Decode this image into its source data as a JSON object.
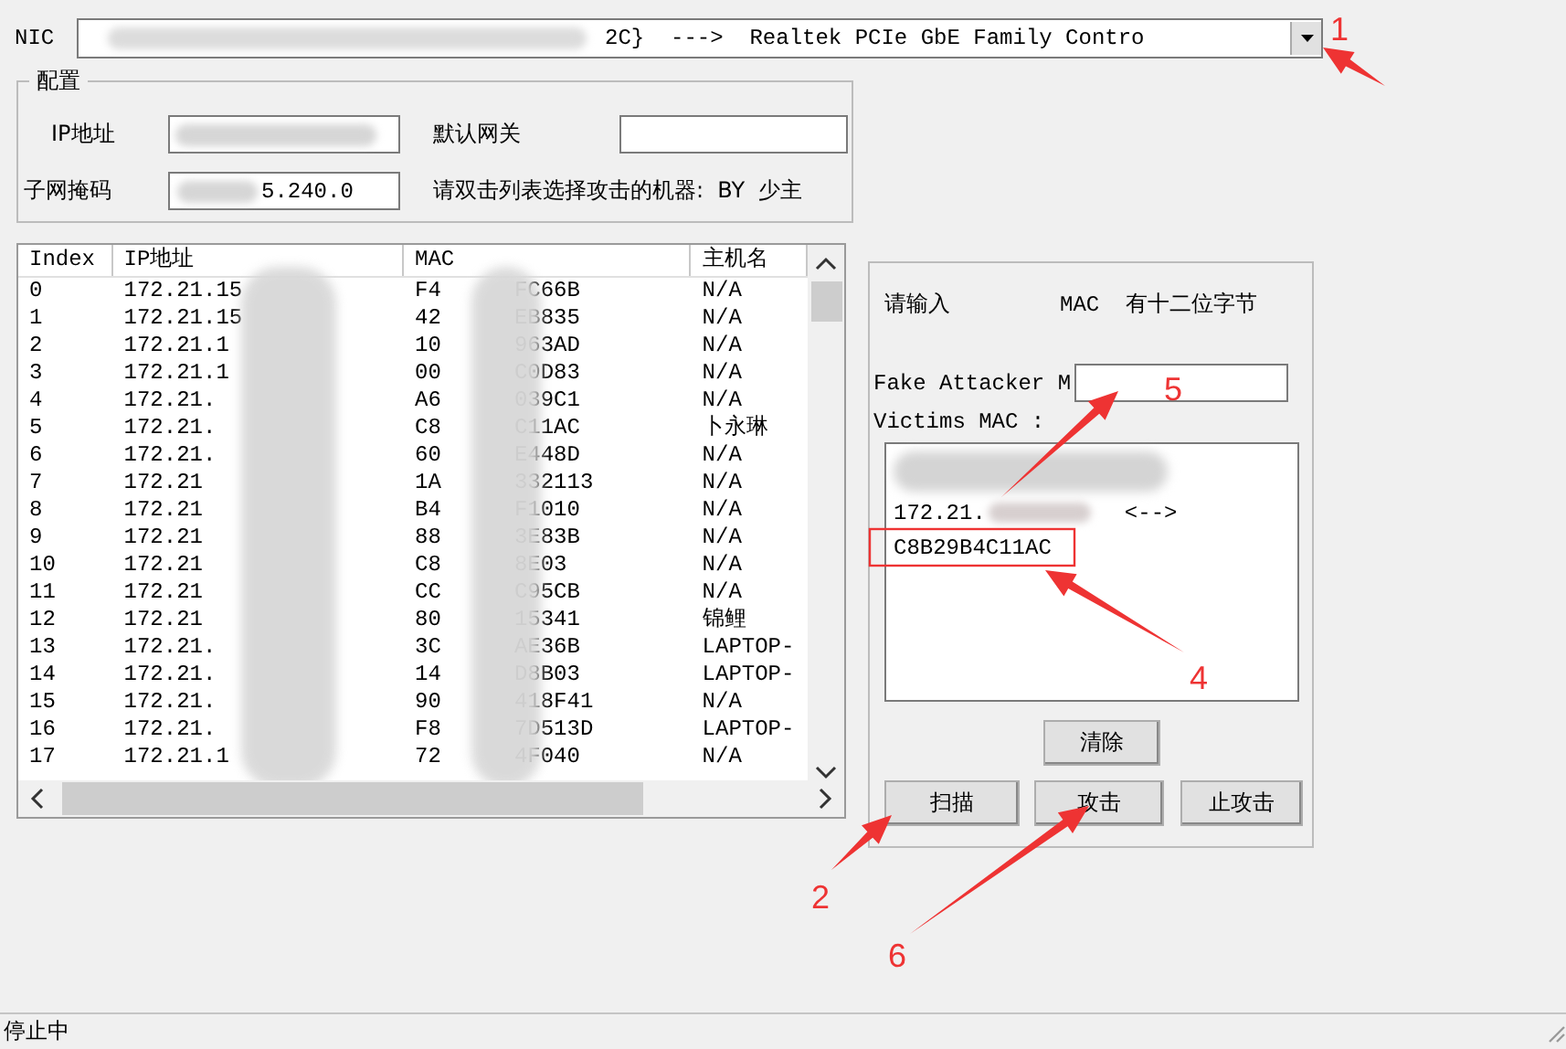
{
  "nic": {
    "label": "NIC",
    "value": "2C}  --->  Realtek PCIe GbE Family Contro"
  },
  "config": {
    "title": "配置",
    "ip_label": "IP地址",
    "gateway_label": "默认网关",
    "mask_label": "子网掩码",
    "mask_value": "5.240.0",
    "hint": "请双击列表选择攻击的机器:  BY  少主"
  },
  "table": {
    "columns": [
      "Index",
      "IP地址",
      "MAC",
      "主机名"
    ],
    "rows": [
      {
        "index": "0",
        "ip": "172.21.15",
        "mac_head": "F4",
        "mac_tail": "FC66B",
        "host": "N/A"
      },
      {
        "index": "1",
        "ip": "172.21.15",
        "mac_head": "42",
        "mac_tail": "EB835",
        "host": "N/A"
      },
      {
        "index": "2",
        "ip": "172.21.1",
        "mac_head": "10",
        "mac_tail": "963AD",
        "host": "N/A"
      },
      {
        "index": "3",
        "ip": "172.21.1",
        "mac_head": "00",
        "mac_tail": "C0D83",
        "host": "N/A"
      },
      {
        "index": "4",
        "ip": "172.21.",
        "mac_head": "A6",
        "mac_tail": "039C1",
        "host": "N/A"
      },
      {
        "index": "5",
        "ip": "172.21.",
        "mac_head": "C8",
        "mac_tail": "C11AC",
        "host": "卜永琳"
      },
      {
        "index": "6",
        "ip": "172.21.",
        "mac_head": "60",
        "mac_tail": "E448D",
        "host": "N/A"
      },
      {
        "index": "7",
        "ip": "172.21",
        "mac_head": "1A",
        "mac_tail": "332113",
        "host": "N/A"
      },
      {
        "index": "8",
        "ip": "172.21",
        "mac_head": "B4",
        "mac_tail": "F1010",
        "host": "N/A"
      },
      {
        "index": "9",
        "ip": "172.21",
        "mac_head": "88",
        "mac_tail": "3E83B",
        "host": "N/A"
      },
      {
        "index": "10",
        "ip": "172.21",
        "mac_head": "C8",
        "mac_tail": "8E03",
        "host": "N/A"
      },
      {
        "index": "11",
        "ip": "172.21",
        "mac_head": "CC",
        "mac_tail": "C95CB",
        "host": "N/A"
      },
      {
        "index": "12",
        "ip": "172.21",
        "mac_head": "80",
        "mac_tail": "15341",
        "host": "锦鲤"
      },
      {
        "index": "13",
        "ip": "172.21.",
        "mac_head": "3C",
        "mac_tail": "AE36B",
        "host": "LAPTOP-"
      },
      {
        "index": "14",
        "ip": "172.21.",
        "mac_head": "14",
        "mac_tail": "D8B03",
        "host": "LAPTOP-"
      },
      {
        "index": "15",
        "ip": "172.21.",
        "mac_head": "90",
        "mac_tail": "418F41",
        "host": "N/A"
      },
      {
        "index": "16",
        "ip": "172.21.",
        "mac_head": "F8",
        "mac_tail": "7D513D",
        "host": "LAPTOP-"
      },
      {
        "index": "17",
        "ip": "172.21.1",
        "mac_head": "72",
        "mac_tail": "4F040",
        "host": "N/A"
      }
    ]
  },
  "attack": {
    "prompt": "请输入",
    "mac_note": "MAC  有十二位字节",
    "fake_label": "Fake Attacker M",
    "victims_label": "Victims MAC :",
    "victims": [
      {
        "ip": "172.21.",
        "arrow": "<-->"
      },
      {
        "mac": "C8B29B4C11AC"
      }
    ],
    "clear_button": "清除",
    "buttons": [
      "扫描",
      "攻击",
      "止攻击"
    ]
  },
  "annotations": [
    {
      "label": "1"
    },
    {
      "label": "2"
    },
    {
      "label": "4"
    },
    {
      "label": "5"
    },
    {
      "label": "6"
    }
  ],
  "status_bar": "停止中"
}
